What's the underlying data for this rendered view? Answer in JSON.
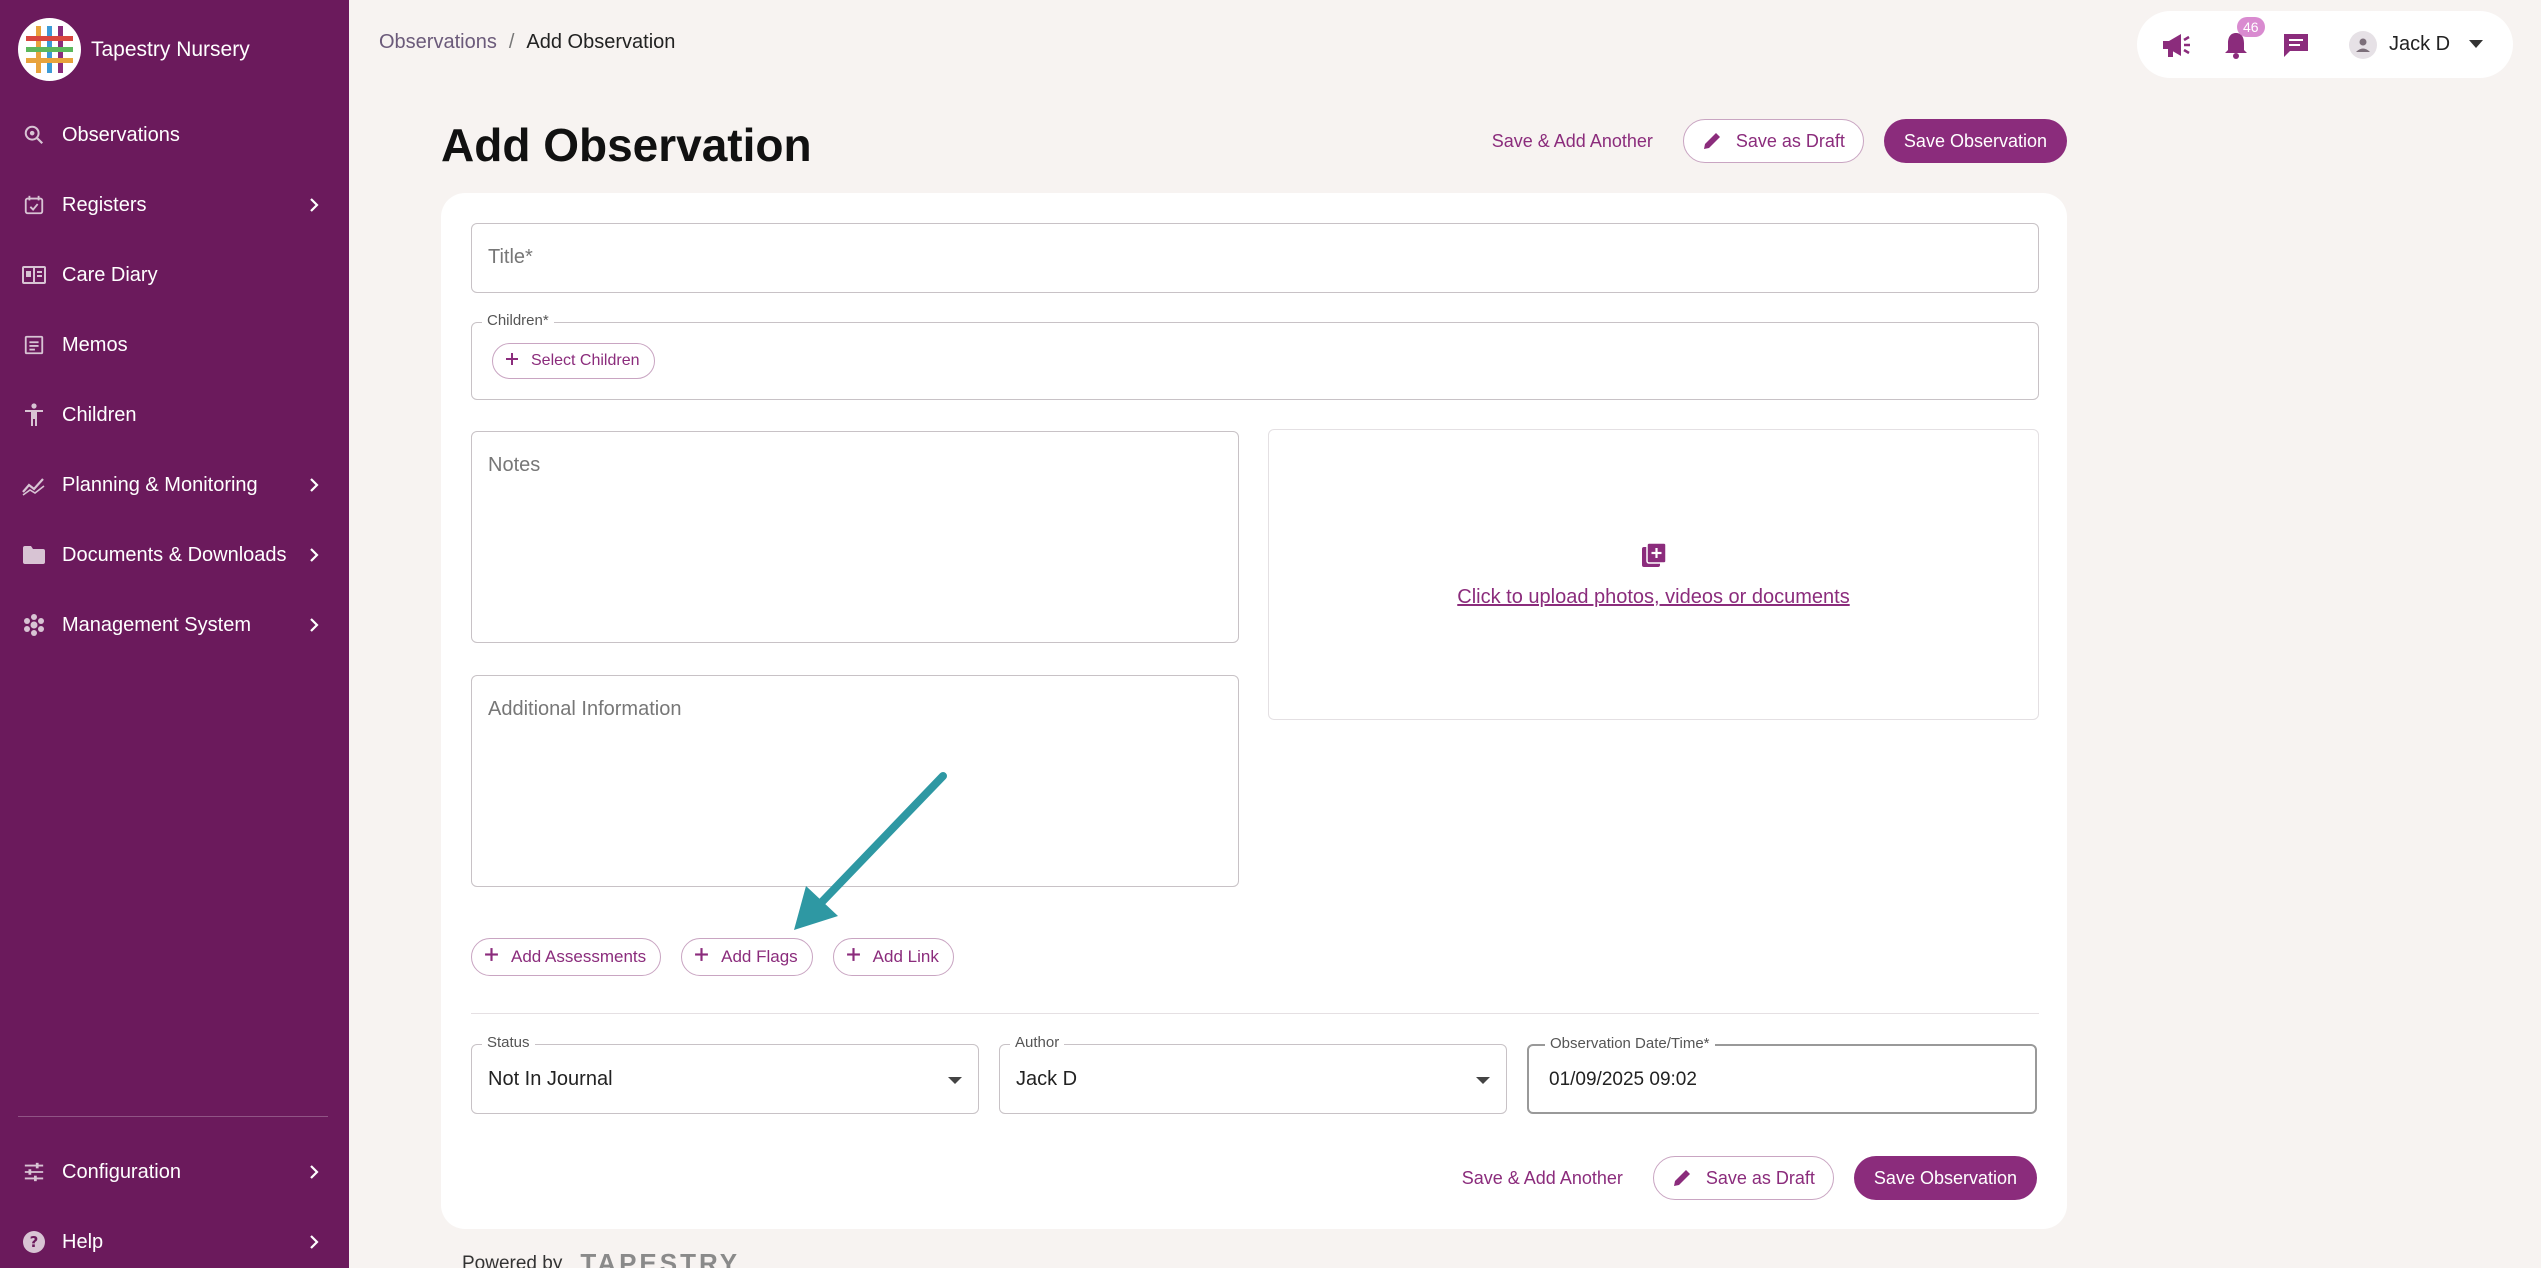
{
  "brand": {
    "name": "Tapestry Nursery"
  },
  "sidebar": {
    "items": [
      {
        "label": "Observations",
        "icon": "search-icon",
        "has_chevron": false
      },
      {
        "label": "Registers",
        "icon": "calendar-check-icon",
        "has_chevron": true
      },
      {
        "label": "Care Diary",
        "icon": "diary-icon",
        "has_chevron": false
      },
      {
        "label": "Memos",
        "icon": "memo-icon",
        "has_chevron": false
      },
      {
        "label": "Children",
        "icon": "child-icon",
        "has_chevron": false
      },
      {
        "label": "Planning & Monitoring",
        "icon": "chart-line-icon",
        "has_chevron": true
      },
      {
        "label": "Documents & Downloads",
        "icon": "folder-icon",
        "has_chevron": true
      },
      {
        "label": "Management System",
        "icon": "hexagons-icon",
        "has_chevron": true
      }
    ],
    "bottom_items": [
      {
        "label": "Configuration",
        "icon": "sliders-icon",
        "has_chevron": true
      },
      {
        "label": "Help",
        "icon": "help-icon",
        "has_chevron": true
      }
    ]
  },
  "breadcrumb": {
    "parent": "Observations",
    "separator": "/",
    "current": "Add Observation"
  },
  "topbar": {
    "notification_count": "46",
    "user_name": "Jack D"
  },
  "page": {
    "title": "Add Observation"
  },
  "actions": {
    "save_add_another": "Save & Add Another",
    "save_draft": "Save as Draft",
    "save_observation": "Save Observation"
  },
  "form": {
    "title_placeholder": "Title*",
    "children_legend": "Children*",
    "select_children": "Select Children",
    "notes_placeholder": "Notes",
    "additional_info_placeholder": "Additional Information",
    "upload_text": "Click to upload photos, videos or documents",
    "add_assessments": "Add Assessments",
    "add_flags": "Add Flags",
    "add_link": "Add Link",
    "status_legend": "Status",
    "status_value": "Not In Journal",
    "author_legend": "Author",
    "author_value": "Jack D",
    "date_legend": "Observation Date/Time*",
    "date_value": "01/09/2025 09:02"
  },
  "footer": {
    "powered_by": "Powered by",
    "logo_text": "TAPESTRY"
  },
  "colors": {
    "sidebar": "#6b1a5c",
    "accent": "#8b2c7c",
    "annotation_arrow": "#2e98a3"
  }
}
